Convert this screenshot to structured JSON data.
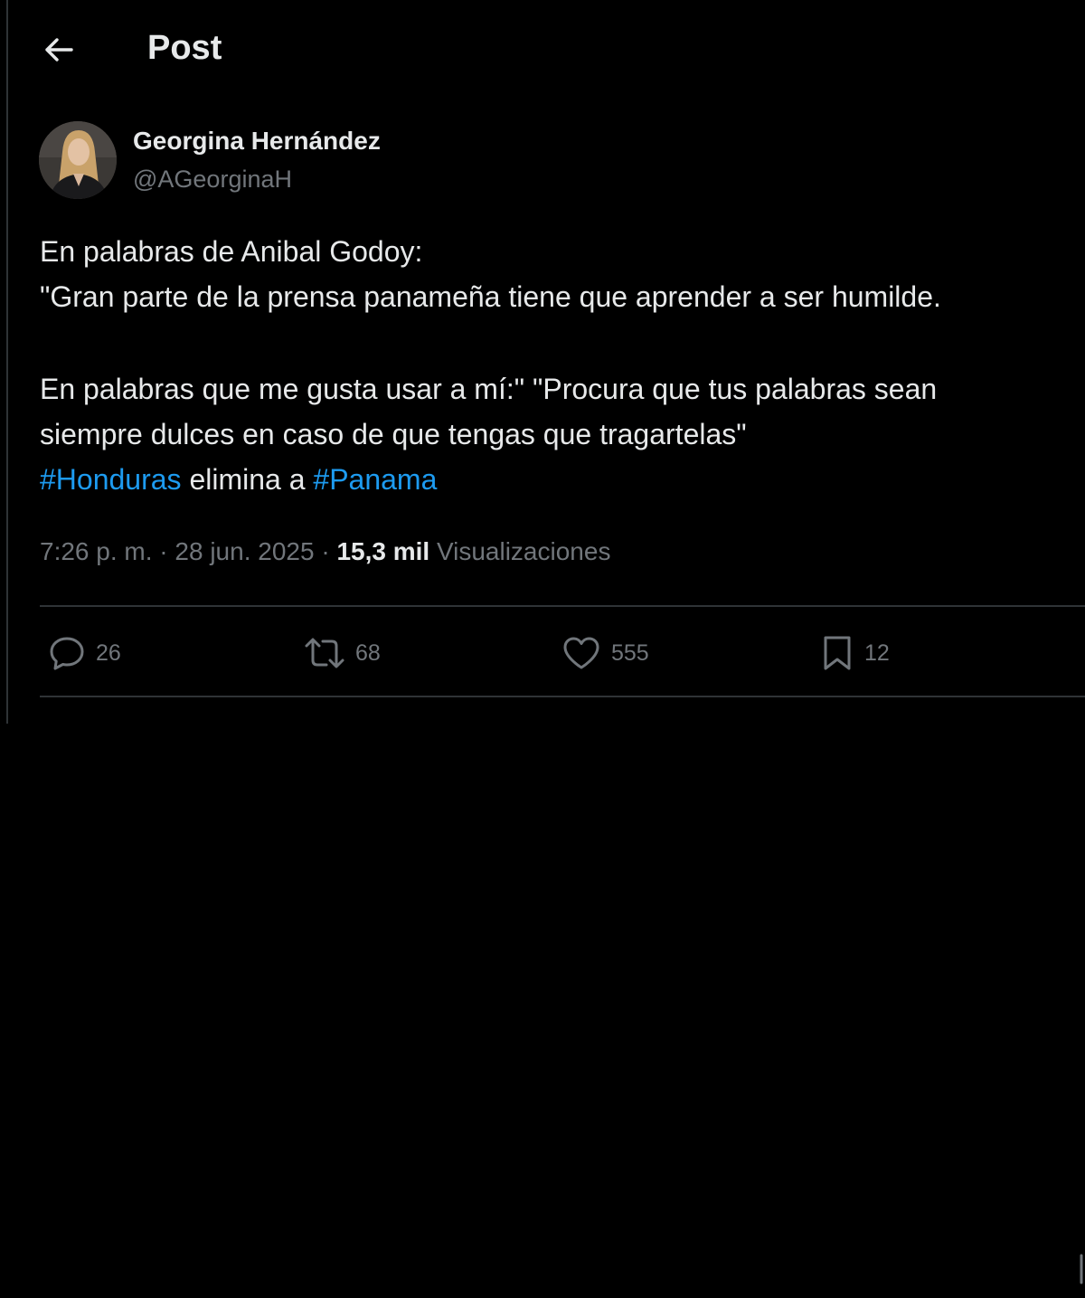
{
  "header": {
    "title": "Post",
    "back_icon": "arrow-left-icon"
  },
  "author": {
    "display_name": "Georgina Hernández",
    "handle": "@AGeorginaH"
  },
  "post": {
    "line1": "En palabras de Anibal Godoy:",
    "line2": "\"Gran parte de la prensa panameña tiene que aprender a ser humilde.",
    "line3": "En palabras que me gusta usar a mí:\" \"Procura que tus palabras sean",
    "line4": "siempre dulces en caso de que tengas que tragartelas\"",
    "hashtag1": "#Honduras",
    "middle_text": " elimina a ",
    "hashtag2": "#Panama"
  },
  "meta": {
    "time": "7:26 p. m.",
    "separator": " · ",
    "date": "28 jun. 2025",
    "views_count": "15,3 mil",
    "views_label": " Visualizaciones"
  },
  "actions": {
    "replies": "26",
    "reposts": "68",
    "likes": "555",
    "bookmarks": "12"
  },
  "colors": {
    "background": "#000000",
    "text_primary": "#e7e9ea",
    "text_secondary": "#71767b",
    "hashtag": "#1d9bf0",
    "divider": "#2f3336"
  }
}
